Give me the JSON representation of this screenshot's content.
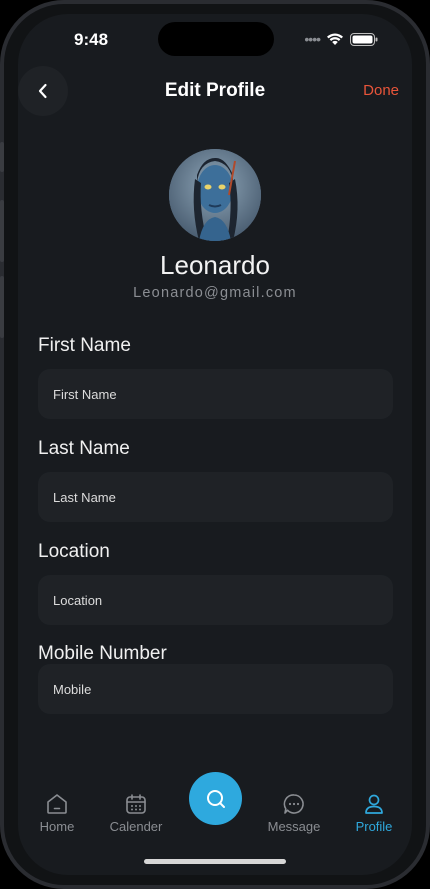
{
  "status_bar": {
    "time": "9:48",
    "signal_icon": "signal-dots-icon",
    "wifi_icon": "wifi-icon",
    "battery_icon": "battery-icon"
  },
  "header": {
    "title": "Edit Profile",
    "done_label": "Done",
    "back_icon": "chevron-left-icon"
  },
  "profile": {
    "name": "Leonardo",
    "email": "Leonardo@gmail.com"
  },
  "form": {
    "first_name": {
      "label": "First Name",
      "placeholder": "First Name",
      "value": ""
    },
    "last_name": {
      "label": "Last Name",
      "placeholder": "Last Name",
      "value": ""
    },
    "location": {
      "label": "Location",
      "placeholder": "Location",
      "value": ""
    },
    "mobile": {
      "label": "Mobile Number",
      "placeholder": "Mobile",
      "value": ""
    }
  },
  "nav": {
    "items": [
      {
        "label": "Home",
        "icon": "home-icon",
        "active": false
      },
      {
        "label": "Calender",
        "icon": "calendar-icon",
        "active": false
      },
      {
        "label": "",
        "icon": "search-icon",
        "active": false
      },
      {
        "label": "Message",
        "icon": "message-icon",
        "active": false
      },
      {
        "label": "Profile",
        "icon": "user-icon",
        "active": true
      }
    ]
  },
  "colors": {
    "accent": "#2ea9de",
    "done": "#e8553a",
    "background": "#181b1f",
    "input_bg": "#1f2226"
  }
}
